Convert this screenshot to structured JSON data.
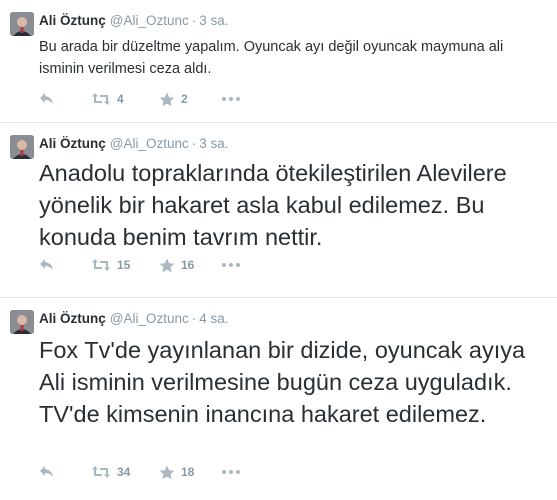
{
  "tweets": [
    {
      "fullname": "Ali Öztunç",
      "username": "@Ali_Oztunc",
      "separator": "·",
      "time": "3 sa.",
      "text": "Bu arada bir düzeltme yapalım. Oyuncak ayı değil oyuncak maymuna ali isminin verilmesi ceza aldı.",
      "retweets": "4",
      "favorites": "2"
    },
    {
      "fullname": "Ali Öztunç",
      "username": "@Ali_Oztunc",
      "separator": "·",
      "time": "3 sa.",
      "text": "Anadolu topraklarında ötekileştirilen Alevilere yönelik bir hakaret asla kabul edilemez. Bu konuda benim tavrım nettir.",
      "retweets": "15",
      "favorites": "16"
    },
    {
      "fullname": "Ali Öztunç",
      "username": "@Ali_Oztunc",
      "separator": "·",
      "time": "4 sa.",
      "text": "Fox Tv'de yayınlanan bir dizide, oyuncak ayıya Ali isminin verilmesine bugün ceza uyguladık. TV'de kimsenin inancına hakaret edilemez.",
      "retweets": "34",
      "favorites": "18"
    }
  ],
  "icons": {
    "reply": "reply-icon",
    "retweet": "retweet-icon",
    "favorite": "star-icon",
    "more": "more-icon"
  },
  "colors": {
    "text": "#292f33",
    "muted": "#8899a6",
    "icon": "#aab8c2",
    "divider": "#e1e8ed"
  }
}
